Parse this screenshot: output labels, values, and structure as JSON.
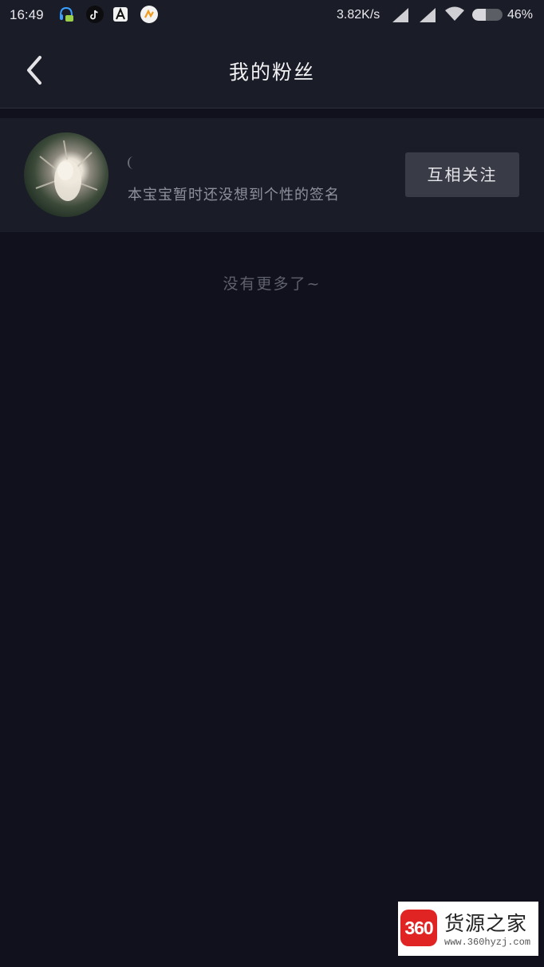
{
  "status_bar": {
    "time": "16:49",
    "network_speed": "3.82K/s",
    "battery_percent": "46%",
    "battery_level": 0.46,
    "icons": [
      "headset-chat-app-icon",
      "tiktok-app-icon",
      "a-app-icon",
      "orange-app-icon",
      "signal-icon",
      "signal-icon",
      "wifi-icon",
      "battery-icon"
    ]
  },
  "header": {
    "back_icon": "chevron-left-icon",
    "title": "我的粉丝"
  },
  "fans": [
    {
      "avatar": "avatar-image",
      "name": "",
      "signature": "本宝宝暂时还没想到个性的签名",
      "button_label": "互相关注"
    }
  ],
  "footer_text": "没有更多了~",
  "watermark": {
    "logo_text": "360",
    "title": "货源之家",
    "url": "www.360hyzj.com",
    "brand_color": "#e02424"
  },
  "colors": {
    "background": "#10111c",
    "bar_background": "#1a1c27",
    "button_background": "#393b47"
  }
}
